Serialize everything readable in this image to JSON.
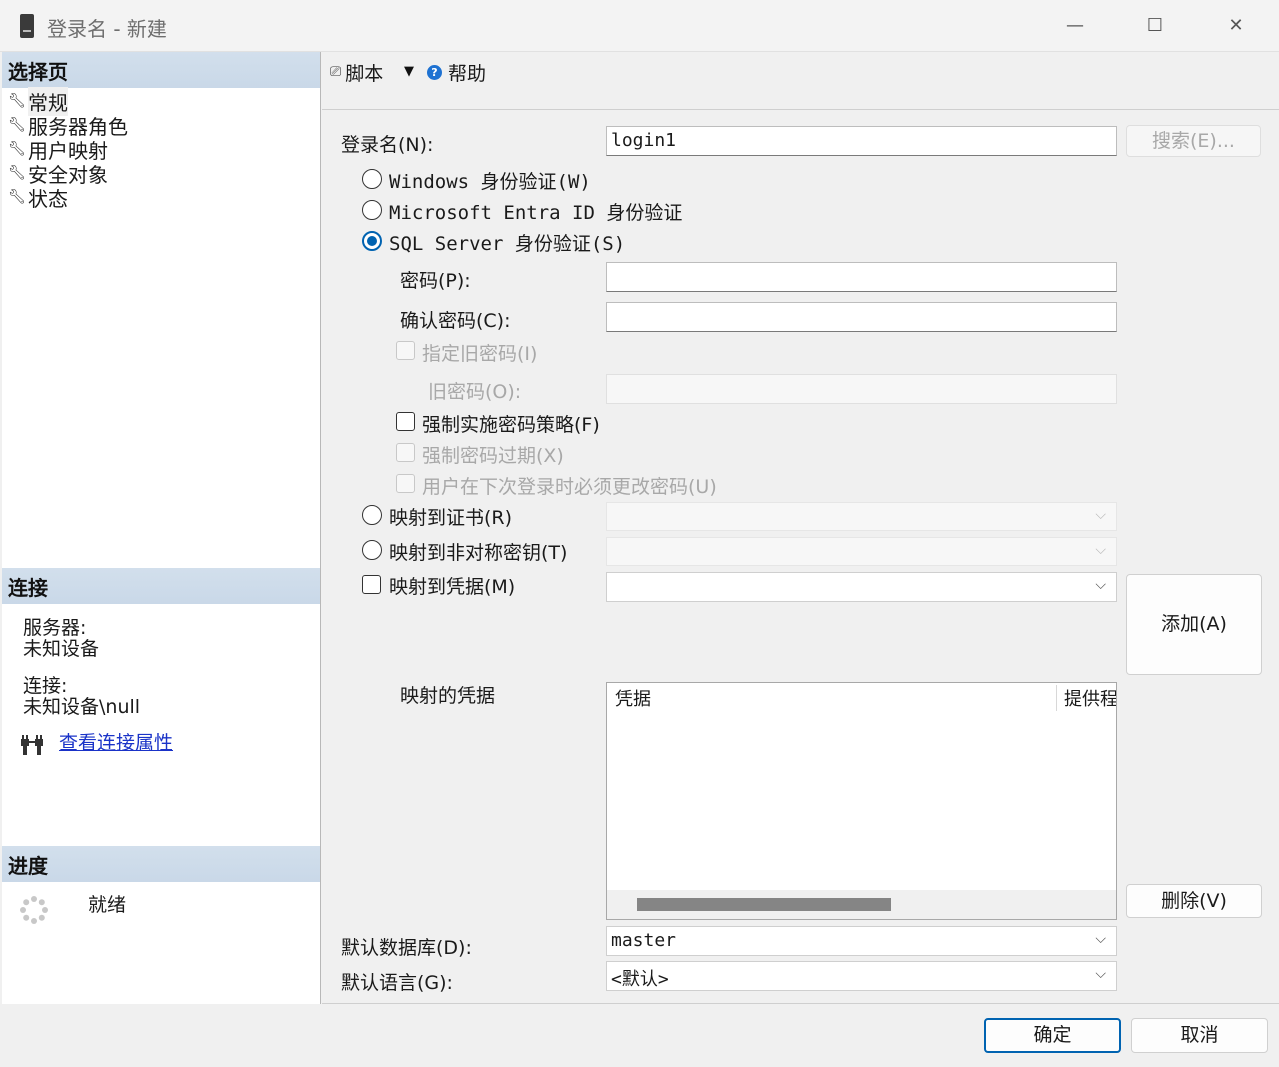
{
  "window": {
    "title": "登录名 - 新建",
    "minimize_glyph": "—",
    "maximize_glyph": "☐",
    "close_glyph": "✕"
  },
  "left": {
    "select_page_header": "选择页",
    "pages": [
      "常规",
      "服务器角色",
      "用户映射",
      "安全对象",
      "状态"
    ],
    "connection_header": "连接",
    "server_label": "服务器:",
    "server_value": "未知设备",
    "connection_label": "连接:",
    "connection_value": "未知设备\\null",
    "view_connection_link": "查看连接属性",
    "progress_header": "进度",
    "progress_status": "就绪"
  },
  "toolbar": {
    "script_label": "脚本",
    "help_label": "帮助"
  },
  "form": {
    "login_name_label": "登录名(N):",
    "login_name_value": "login1",
    "search_button": "搜索(E)...",
    "auth_windows": "Windows 身份验证(W)",
    "auth_entra": "Microsoft Entra ID 身份验证",
    "auth_sql": "SQL Server 身份验证(S)",
    "password_label": "密码(P):",
    "confirm_password_label": "确认密码(C):",
    "specify_old_password": "指定旧密码(I)",
    "old_password_label": "旧密码(O):",
    "enforce_policy": "强制实施密码策略(F)",
    "enforce_expiration": "强制密码过期(X)",
    "must_change": "用户在下次登录时必须更改密码(U)",
    "map_certificate": "映射到证书(R)",
    "map_asym_key": "映射到非对称密钥(T)",
    "map_credential": "映射到凭据(M)",
    "add_button": "添加(A)",
    "mapped_credentials_label": "映射的凭据",
    "cred_table_headers": [
      "凭据",
      "提供程"
    ],
    "remove_button": "删除(V)",
    "default_db_label": "默认数据库(D):",
    "default_db_value": "master",
    "default_lang_label": "默认语言(G):",
    "default_lang_value": "<默认>"
  },
  "footer": {
    "ok_button": "确定",
    "cancel_button": "取消"
  }
}
